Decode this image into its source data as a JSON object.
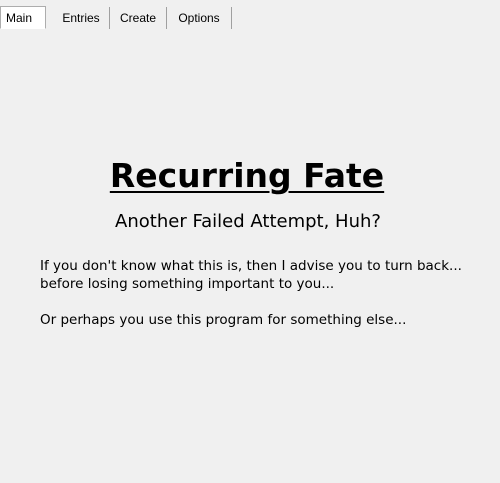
{
  "tabs": [
    {
      "label": "Main",
      "active": true
    },
    {
      "label": "Entries",
      "active": false
    },
    {
      "label": "Create",
      "active": false
    },
    {
      "label": "Options",
      "active": false
    }
  ],
  "main": {
    "title": "Recurring Fate",
    "subtitle": "Another Failed Attempt, Huh?",
    "paragraph_lines": [
      "If you don't know what this is, then I advise you to turn back...",
      "before losing something important to you...",
      "Or perhaps you use this program for something else..."
    ]
  },
  "colors": {
    "background": "#f0f0f0",
    "text": "#000000",
    "active_tab": "#ffffff"
  }
}
